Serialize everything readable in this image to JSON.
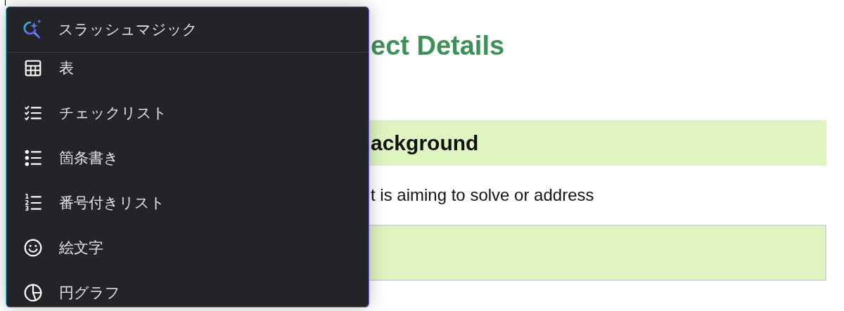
{
  "document": {
    "title": "ect Details",
    "section_heading": "ackground",
    "body_text": "t is aiming to solve or address",
    "answer_box": {
      "kind": "empty"
    }
  },
  "slash_menu": {
    "header": {
      "label": "スラッシュマジック",
      "kind": "magic"
    },
    "items": [
      {
        "label": "表",
        "kind": "table"
      },
      {
        "label": "チェックリスト",
        "kind": "checklist"
      },
      {
        "label": "箇条書き",
        "kind": "bullets"
      },
      {
        "label": "番号付きリスト",
        "kind": "numbered",
        "icon_digits": [
          "1",
          "2",
          "3"
        ]
      },
      {
        "label": "絵文字",
        "kind": "emoji"
      },
      {
        "label": "円グラフ",
        "kind": "pie"
      }
    ]
  }
}
